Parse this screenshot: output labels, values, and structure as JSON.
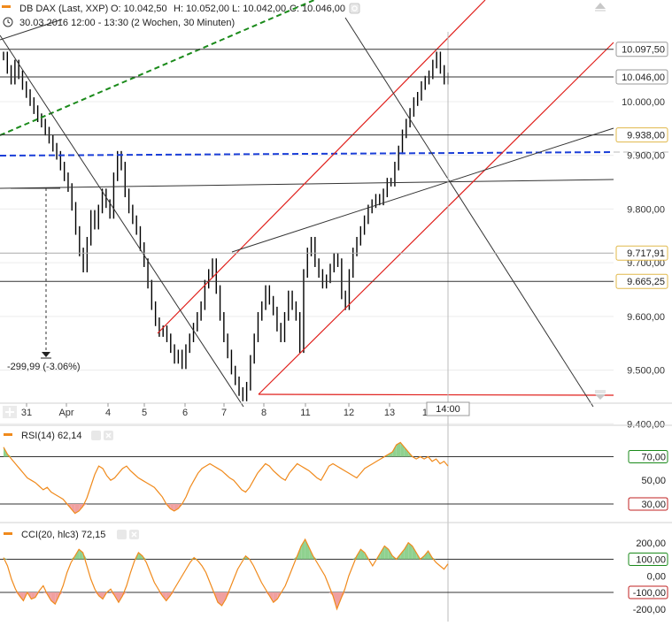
{
  "header": {
    "instrument": "DB DAX (Last, XXP)",
    "open": "O: 10.042,50",
    "high": "H: 10.052,00",
    "low": "L: 10.042,00",
    "close": "C: 10.046,00",
    "period": "30.03.2016 12:00 - 13:30 (2 Wochen, 30 Minuten)"
  },
  "colors": {
    "candle": "#000000",
    "trend_red": "#e0201c",
    "trend_green": "#1a8a1a",
    "trend_blue": "#1a3ed8",
    "indicator": "#f08a1c",
    "fill_high": "#8fd18f",
    "fill_low": "#f0a0a0"
  },
  "chart_data": [
    {
      "type": "line",
      "panel": "price",
      "ylim": [
        9440,
        10130
      ],
      "y_ticks": [
        "10.000,00",
        "9.900,00",
        "9.800,00",
        "9.700,00",
        "9.600,00",
        "9.500,00",
        "9.400,00"
      ],
      "x_labels": [
        "31",
        "Apr",
        "4",
        "5",
        "6",
        "7",
        "8",
        "11",
        "12",
        "13",
        "14"
      ],
      "crosshair_label": "14:00",
      "price_tags": [
        "10.097,50",
        "10.046,00",
        "9.938,00",
        "9.717,91",
        "9.665,25"
      ],
      "measurement": "-299,99 (-3.06%)",
      "series": [
        {
          "values": [
            10085,
            10060,
            10040,
            10070,
            10050,
            10030,
            10015,
            10000,
            9985,
            9970,
            9960,
            9945,
            9930,
            9915,
            9900,
            9880,
            9860,
            9840,
            9805,
            9760,
            9720,
            9690,
            9740,
            9790,
            9770,
            9800,
            9830,
            9810,
            9790,
            9860,
            9900,
            9880,
            9830,
            9800,
            9780,
            9760,
            9730,
            9700,
            9660,
            9620,
            9590,
            9570,
            9575,
            9560,
            9540,
            9520,
            9530,
            9510,
            9540,
            9560,
            9580,
            9600,
            9620,
            9660,
            9680,
            9700,
            9650,
            9600,
            9560,
            9530,
            9500,
            9480,
            9460,
            9450,
            9470,
            9520,
            9560,
            9600,
            9620,
            9650,
            9630,
            9610,
            9580,
            9560,
            9600,
            9640,
            9620,
            9600,
            9540,
            9680,
            9720,
            9740,
            9700,
            9680,
            9660,
            9670,
            9690,
            9710,
            9700,
            9640,
            9620,
            9680,
            9720,
            9740,
            9760,
            9780,
            9800,
            9810,
            9820,
            9815,
            9830,
            9850,
            9850,
            9880,
            9910,
            9940,
            9960,
            9980,
            10000,
            10010,
            10030,
            10040,
            10050,
            10070,
            10085,
            10060,
            10040,
            10046
          ]
        }
      ]
    },
    {
      "type": "area",
      "panel": "indicator",
      "title": "RSI(14)  62,14",
      "ylim": [
        15,
        95
      ],
      "levels": [
        "70,00",
        "50,00",
        "30,00"
      ],
      "series": [
        {
          "name": "RSI(14)",
          "values": [
            78,
            72,
            68,
            64,
            60,
            56,
            52,
            50,
            48,
            45,
            42,
            44,
            40,
            38,
            36,
            34,
            30,
            26,
            22,
            24,
            28,
            35,
            45,
            55,
            62,
            60,
            54,
            50,
            52,
            56,
            60,
            62,
            58,
            55,
            52,
            50,
            48,
            46,
            44,
            40,
            36,
            30,
            26,
            24,
            26,
            30,
            36,
            44,
            50,
            56,
            60,
            62,
            64,
            62,
            60,
            58,
            55,
            52,
            50,
            46,
            42,
            40,
            44,
            50,
            56,
            60,
            64,
            62,
            58,
            55,
            52,
            50,
            56,
            60,
            64,
            62,
            60,
            58,
            55,
            52,
            50,
            56,
            62,
            64,
            62,
            60,
            58,
            56,
            54,
            52,
            56,
            60,
            62,
            64,
            66,
            68,
            70,
            72,
            74,
            80,
            82,
            78,
            74,
            70,
            68,
            70,
            68,
            70,
            66,
            68,
            64,
            66,
            62
          ]
        }
      ]
    },
    {
      "type": "area",
      "panel": "indicator",
      "title": "CCI(20, hlc3)  72,15",
      "ylim": [
        -260,
        300
      ],
      "levels": [
        "200,00",
        "100,00",
        "0,00",
        "-100,00",
        "-200,00"
      ],
      "series": [
        {
          "name": "CCI(20, hlc3)",
          "values": [
            110,
            60,
            -20,
            -80,
            -120,
            -150,
            -100,
            -140,
            -130,
            -90,
            -60,
            -110,
            -150,
            -170,
            -120,
            -60,
            20,
            80,
            120,
            160,
            140,
            60,
            -20,
            -80,
            -120,
            -140,
            -100,
            -80,
            -120,
            -160,
            -120,
            -60,
            20,
            90,
            140,
            120,
            80,
            20,
            -40,
            -80,
            -120,
            -150,
            -120,
            -80,
            -40,
            0,
            40,
            80,
            110,
            90,
            60,
            20,
            -40,
            -100,
            -160,
            -180,
            -140,
            -80,
            -20,
            40,
            80,
            120,
            100,
            60,
            10,
            -40,
            -80,
            -120,
            -160,
            -140,
            -100,
            -60,
            0,
            60,
            120,
            180,
            220,
            170,
            120,
            80,
            40,
            0,
            -60,
            -120,
            -200,
            -140,
            -80,
            0,
            60,
            120,
            160,
            140,
            100,
            60,
            100,
            140,
            180,
            160,
            120,
            100,
            130,
            160,
            200,
            180,
            140,
            100,
            120,
            150,
            110,
            80,
            60,
            40,
            72
          ]
        }
      ]
    }
  ]
}
